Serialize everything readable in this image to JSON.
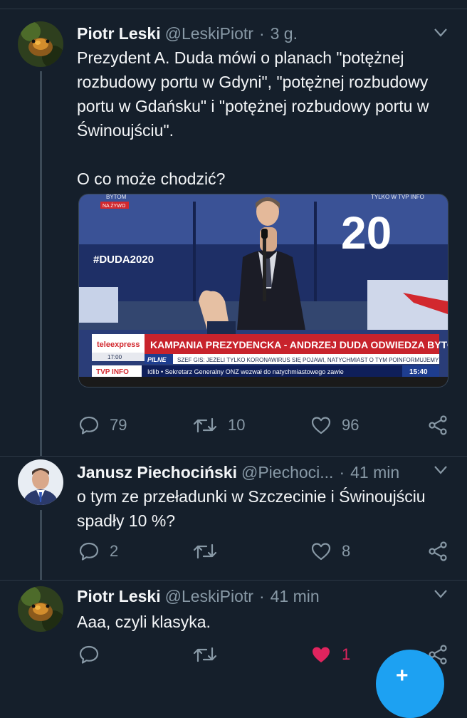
{
  "tweets": [
    {
      "name": "Piotr Leski",
      "handle": "@LeskiPiotr",
      "time": "3 g.",
      "text": "Prezydent A. Duda mówi o planach \"potężnej rozbudowy portu w Gdyni\", \"potężnej rozbudowy portu w Gdańsku\" i \"potężnej rozbudowy portu w Świnoujściu\".\n\nO co może chodzić?",
      "media": {
        "tv_corner_top": "BYTOM",
        "tv_live": "NA ŻYWO",
        "tv_corner_right": "TYLKO W TVP INFO",
        "hashtag": "#DUDA2020",
        "banner_year": "20",
        "ticker_brand": "teleexpress",
        "ticker_time_small": "17:00",
        "ticker_headline": "KAMPANIA PREZYDENCKA - ANDRZEJ DUDA ODWIEDZA BYTOM",
        "ticker_pilne": "PILNE",
        "ticker_sub": "SZEF GIS: JEŻELI TYLKO KORONAWIRUS SIĘ POJAWI, NATYCHMIAST O TYM POINFORMUJEMY",
        "channel": "TVP INFO",
        "ticker_news": "Idlib • Sekretarz Generalny ONZ wezwał do natychmiastowego zawie",
        "clock": "15:40"
      },
      "reply_count": "79",
      "retweet_count": "10",
      "like_count": "96"
    },
    {
      "name": "Janusz Piechociński",
      "handle": "@Piechoci...",
      "time": "41 min",
      "text": "o tym ze przeładunki w Szczecinie i Świnoujściu spadły 10 %?",
      "reply_count": "2",
      "retweet_count": "",
      "like_count": "8"
    },
    {
      "name": "Piotr Leski",
      "handle": "@LeskiPiotr",
      "time": "41 min",
      "text": "Aaa, czyli klasyka.",
      "reply_count": "",
      "retweet_count": "",
      "like_count": "1"
    }
  ],
  "separator": "·",
  "fab_icon": "+",
  "colors": {
    "background": "#151f2b",
    "muted": "#8899a6",
    "like_active": "#e0245e",
    "accent": "#1da1f2"
  }
}
